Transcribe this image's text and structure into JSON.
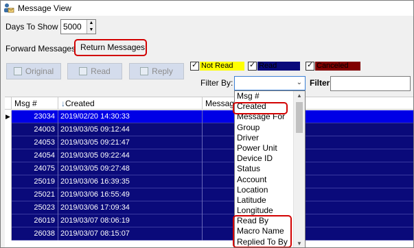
{
  "window": {
    "title": "Message View",
    "icon": "user-mail-icon"
  },
  "days": {
    "label": "Days To Show",
    "value": "5000"
  },
  "tabs": {
    "forward": "Forward Messages",
    "return": "Return Messages"
  },
  "toolbar": {
    "original": "Original",
    "read": "Read",
    "reply": "Reply"
  },
  "legend": {
    "not_read": {
      "label": "Not Read",
      "color": "#ffff00"
    },
    "read": {
      "label": "Read",
      "color": "#0a0a7a"
    },
    "canceled": {
      "label": "Canceled",
      "color": "#800000"
    }
  },
  "filter_by": {
    "label": "Filter By:",
    "value": ""
  },
  "filter": {
    "label": "Filter",
    "value": ""
  },
  "grid": {
    "columns": {
      "msg": "Msg #",
      "created": "Created",
      "message": "Message"
    },
    "sort_indicator": "↓",
    "rows": [
      {
        "msg": "23034",
        "created": "2019/02/20 14:30:33"
      },
      {
        "msg": "24003",
        "created": "2019/03/05 09:12:44"
      },
      {
        "msg": "24053",
        "created": "2019/03/05 09:21:47"
      },
      {
        "msg": "24054",
        "created": "2019/03/05 09:22:44"
      },
      {
        "msg": "24075",
        "created": "2019/03/05 09:27:48"
      },
      {
        "msg": "25019",
        "created": "2019/03/06 16:39:35"
      },
      {
        "msg": "25021",
        "created": "2019/03/06 16:55:49"
      },
      {
        "msg": "25023",
        "created": "2019/03/06 17:09:34"
      },
      {
        "msg": "26019",
        "created": "2019/03/07 08:06:19"
      },
      {
        "msg": "26038",
        "created": "2019/03/07 08:15:07"
      }
    ]
  },
  "dropdown_items": [
    "Msg #",
    "Created",
    "Message For",
    "Group",
    "Driver",
    "Power Unit",
    "Device ID",
    "Status",
    "Account",
    "Location",
    "Latitude",
    "Longitude",
    "Read By",
    "Macro Name",
    "Replied To By"
  ]
}
